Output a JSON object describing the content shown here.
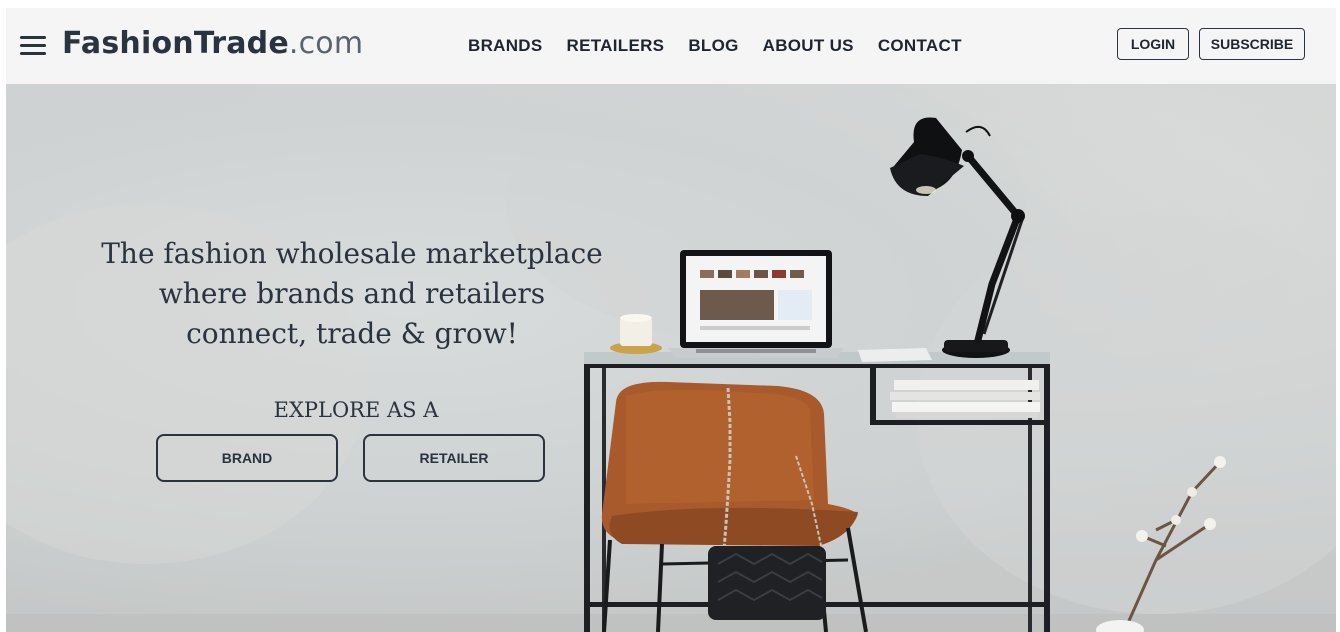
{
  "header": {
    "menu_icon": "hamburger-menu-icon",
    "logo": {
      "name": "FashionTrade",
      "suffix": ".com"
    },
    "nav": [
      "BRANDS",
      "RETAILERS",
      "BLOG",
      "ABOUT US",
      "CONTACT"
    ],
    "login_label": "LOGIN",
    "subscribe_label": "SUBSCRIBE"
  },
  "hero": {
    "headline": [
      "The fashion wholesale marketplace",
      "where brands and retailers",
      "connect, trade & grow!"
    ],
    "explore_label": "EXPLORE AS A",
    "brand_button": "BRAND",
    "retailer_button": "RETAILER"
  },
  "colors": {
    "text_dark": "#2a3340",
    "header_bg": "#f5f5f5",
    "wall": "#cdd1d1",
    "chair_leather": "#a85a2c"
  }
}
